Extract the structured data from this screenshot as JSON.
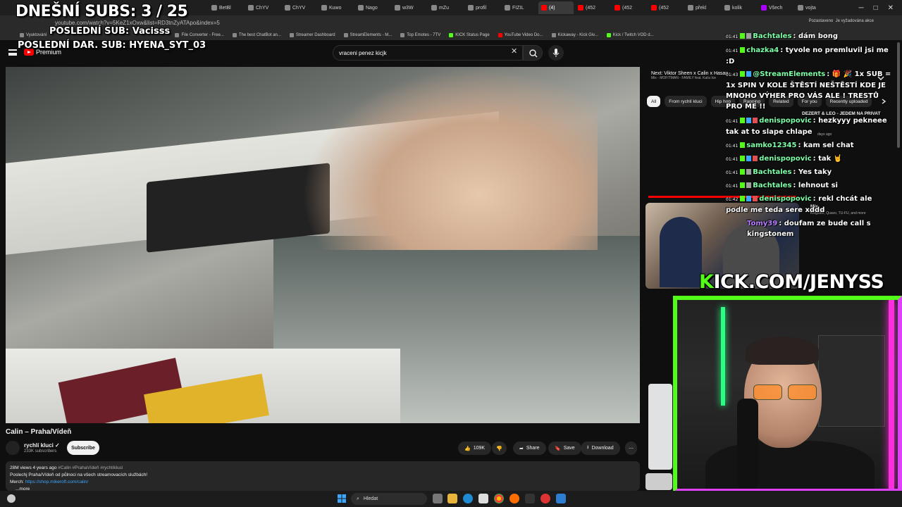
{
  "browser": {
    "tabs": [
      "BetBl",
      "ChYV",
      "ChYV",
      "Kuwo",
      "Nago",
      "w3W",
      "mZu",
      "profil",
      "FIZIL",
      "(4)",
      "(452",
      "(452",
      "(452",
      "překl",
      "kolik",
      "Všech",
      "vojta"
    ],
    "url": "youtube.com/watch?v=5KeZ1xOxw&list=RD3tnZyATApo&index=5",
    "window_controls": [
      "─",
      "□",
      "✕"
    ],
    "bookmarks": [
      "Vyuktování",
      "Sign in",
      "File Converter - Free...",
      "The best ChatBot an...",
      "Streamer Dashboard",
      "StreamElements - M...",
      "Top Emotes - 7TV",
      "KICK Status Page",
      "YouTube Video Do...",
      "Kickaway - Kick Giv...",
      "Kick / Twitch VOD d..."
    ],
    "extras": [
      "Pozastaveno",
      "Je vyžadována akce"
    ]
  },
  "overlay": {
    "subs_today": "DNEŠNÍ SUBS: 3 / 25",
    "last_sub": "POSLEDNÍ SUB: Vacisss",
    "last_donation_sub": "POSLEDNÍ DAR. SUB: HYENA_SYT_03",
    "kick_url_k": "K",
    "kick_url_rest": "ICK.COM/JENYSS"
  },
  "youtube": {
    "logo": "Premium",
    "search_value": "vraceni penez kicjk",
    "video_title": "Calin – Praha/Vídeň",
    "channel_name": "rychlí kluci ✓",
    "channel_subs": "233K subscribers",
    "subscribe": "Subscribe",
    "likes": "109K",
    "share": "Share",
    "save": "Save",
    "download": "Download",
    "more": "⋯",
    "desc_stats": "28M views  4 years ago",
    "desc_tags": "#Calin #PrahaVídeň #rychlíkluci",
    "desc_line1": "Poslechj Praha/Vídeň od půlnoci na všech streamovacích službách!",
    "desc_merch_label": "Merch: ",
    "desc_merch_link": "https://shop.mikeroft.com/calin/",
    "desc_more": "...more",
    "next_title": "Next: Viktor Sheen x Calin x Hasan",
    "next_sub": "Mix - MOFITMAN - FAMILY feat. Kaťa Ice",
    "chips": [
      "All",
      "From rychlí kluci",
      "Hip hop",
      "Rapping",
      "Related",
      "For you",
      "Recently uploaded"
    ],
    "related_title": "DEZERT & LEO - JEDEM NA PRIVAT",
    "related_meta": "days ago",
    "mix_title": "Mix",
    "mix_sub": "Kingston, Quavo, TU-FU, and more"
  },
  "chat": [
    {
      "time": "01:41",
      "user": "Bachtales",
      "text": "dám bong",
      "color": "#7dffa8"
    },
    {
      "time": "01:41",
      "user": "chazka4",
      "text": "tyvole no premluvil jsi me :D",
      "color": "#7dffa8"
    },
    {
      "time": "01:43",
      "user": "@StreamElements",
      "text": "🎁 🎉 1x SUB = 1x SPIN V KOLE ŠTĚSTÍ NEŠTĚSTÍ KDE JE MNOHO VÝHER PRO VÁS ALE ! TRESTŮ PRO ME !!",
      "color": "#7dffa8"
    },
    {
      "time": "01:41",
      "user": "denispopovic",
      "text": "hezkyyy pekneee tak at to slape chlape",
      "color": "#7dffa8"
    },
    {
      "time": "01:41",
      "user": "samko12345",
      "text": "kam sel chat",
      "color": "#7dffa8"
    },
    {
      "time": "01:41",
      "user": "denispopovic",
      "text": "tak 🤘",
      "color": "#7dffa8"
    },
    {
      "time": "01:41",
      "user": "Bachtales",
      "text": "Yes taky",
      "color": "#7dffa8"
    },
    {
      "time": "01:41",
      "user": "Bachtales",
      "text": "lehnout si",
      "color": "#7dffa8"
    },
    {
      "time": "01:42",
      "user": "denispopovic",
      "text": "rekl chcát ale podle me teda sere xddd",
      "color": "#7dffa8"
    },
    {
      "time": "01:42",
      "user": "Tomy39",
      "text": "doufam ze bude call s kingstonem",
      "color": "#b57cff"
    }
  ],
  "taskbar": {
    "search": "Hledat"
  },
  "colors": {
    "kick_green": "#53fc18",
    "neon_pink": "#e040fb",
    "yt_red": "#ff0000"
  }
}
